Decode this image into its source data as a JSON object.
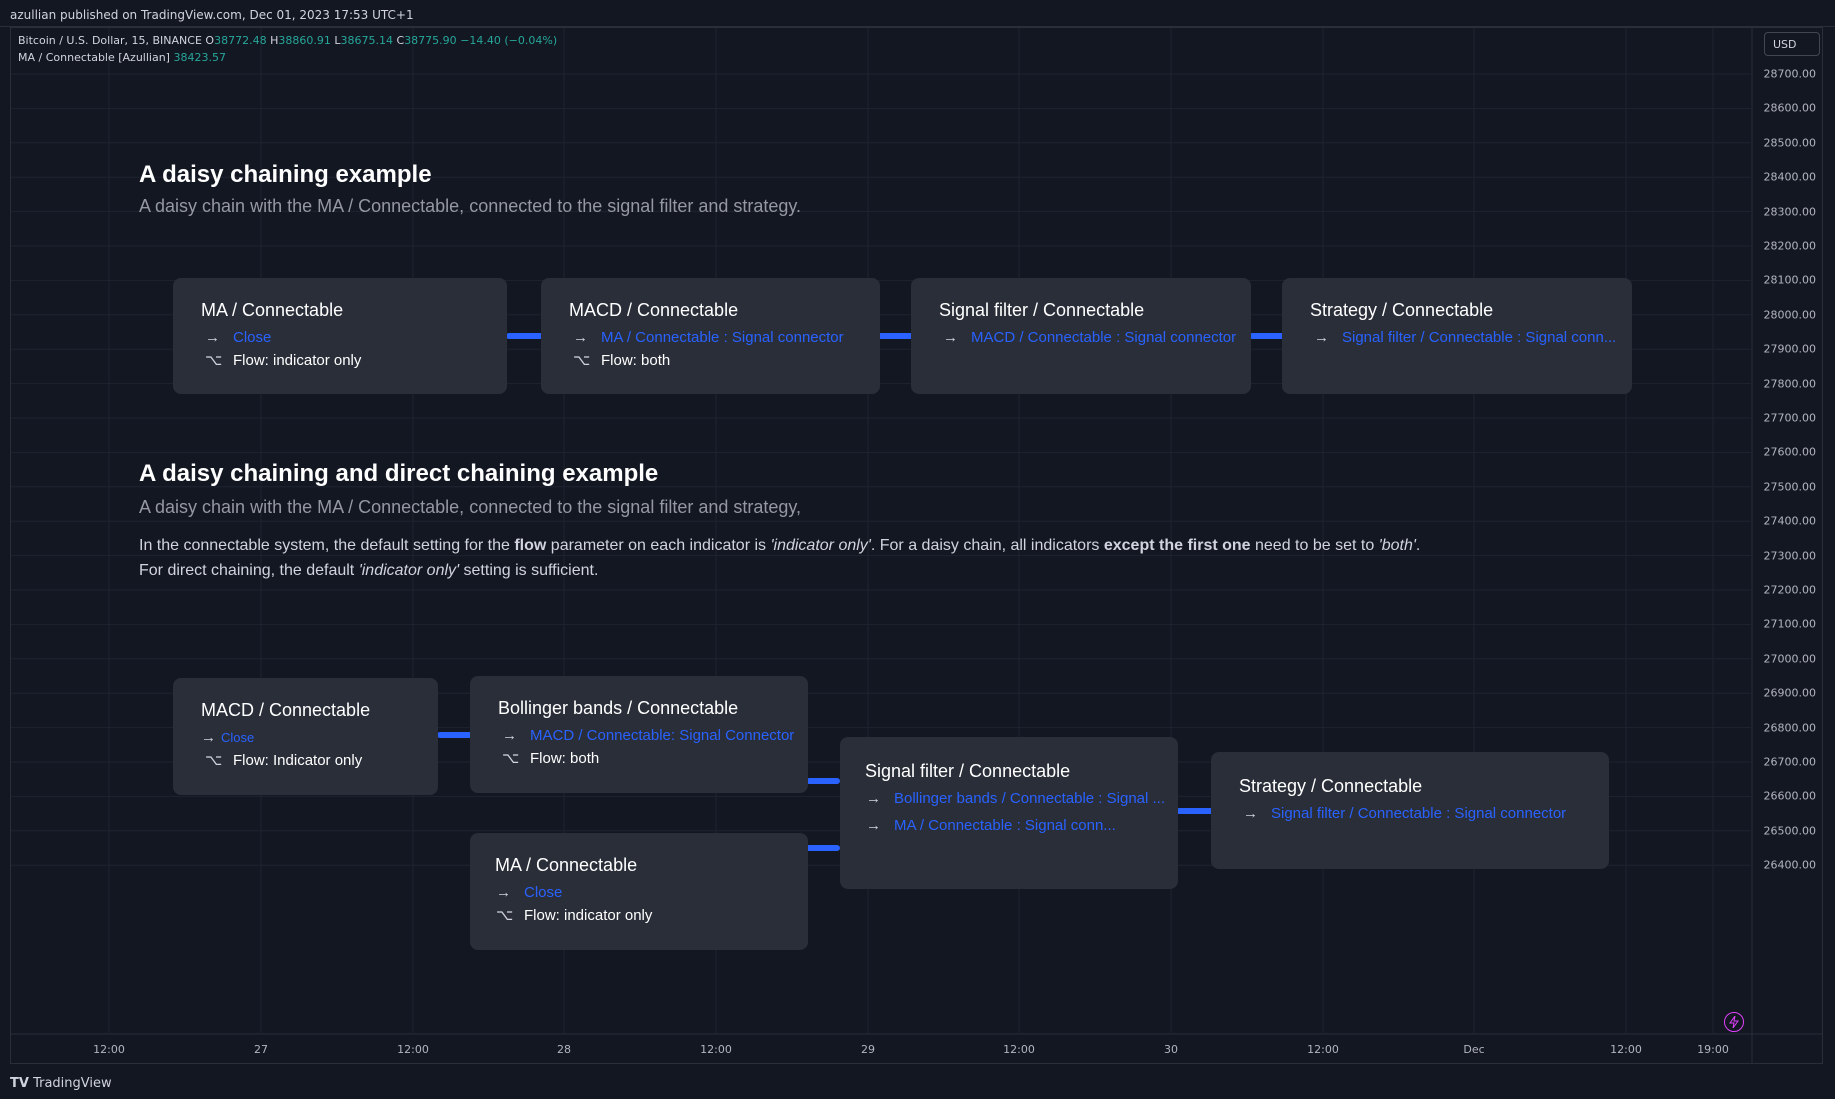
{
  "publish_line": "azullian published on TradingView.com, Dec 01, 2023 17:53 UTC+1",
  "legend": {
    "symbol": "Bitcoin / U.S. Dollar, 15, BINANCE",
    "o_key": "O",
    "o_val": "38772.48",
    "h_key": "H",
    "h_val": "38860.91",
    "l_key": "L",
    "l_val": "38675.14",
    "c_key": "C",
    "c_val": "38775.90",
    "change": "−14.40 (−0.04%)",
    "indicator": "MA / Connectable [Azullian]",
    "indicator_val": "38423.57"
  },
  "currency_button": "USD",
  "price_axis": [
    "28700.00",
    "28600.00",
    "28500.00",
    "28400.00",
    "28300.00",
    "28200.00",
    "28100.00",
    "28000.00",
    "27900.00",
    "27800.00",
    "27700.00",
    "27600.00",
    "27500.00",
    "27400.00",
    "27300.00",
    "27200.00",
    "27100.00",
    "27000.00",
    "26900.00",
    "26800.00",
    "26700.00",
    "26600.00",
    "26500.00",
    "26400.00"
  ],
  "time_axis": [
    "12:00",
    "27",
    "12:00",
    "28",
    "12:00",
    "29",
    "12:00",
    "30",
    "12:00",
    "Dec",
    "12:00",
    "19:00"
  ],
  "section1": {
    "title": "A daisy chaining example",
    "subtitle": "A daisy chain with the MA / Connectable,  connected to the signal filter and strategy."
  },
  "section2": {
    "title": "A daisy chaining and direct chaining example",
    "subtitle": "A daisy chain with the MA / Connectable,  connected to the signal filter and strategy,",
    "para1_a": "In the connectable system, the default setting for the ",
    "para1_b": "flow",
    "para1_c": " parameter on each indicator is ",
    "para1_d": "'indicator only'",
    "para1_e": ". For a daisy chain, all indicators ",
    "para1_f": "except the first one",
    "para1_g": " need to be set to ",
    "para1_h": "'both'",
    "para1_i": ".",
    "para2_a": "For direct chaining, the default ",
    "para2_b": "'indicator only'",
    "para2_c": " setting is sufficient."
  },
  "arrow_glyph": "→",
  "flow_glyph": "⌥",
  "chain1": [
    {
      "title": "MA / Connectable",
      "link": "Close",
      "flow": "Flow: indicator only"
    },
    {
      "title": "MACD / Connectable",
      "link": "MA / Connectable : Signal connector",
      "flow": "Flow: both"
    },
    {
      "title": "Signal filter / Connectable",
      "link": "MACD / Connectable : Signal connector"
    },
    {
      "title": "Strategy / Connectable",
      "link": "Signal filter / Connectable : Signal conn..."
    }
  ],
  "chain2": {
    "macd": {
      "title": "MACD / Connectable",
      "link": "Close",
      "flow": "Flow: Indicator only"
    },
    "bb": {
      "title": "Bollinger bands / Connectable",
      "link": "MACD / Connectable: Signal Connector",
      "flow": "Flow: both"
    },
    "ma": {
      "title": "MA / Connectable",
      "link": "Close",
      "flow": "Flow: indicator only"
    },
    "sf": {
      "title": "Signal filter / Connectable",
      "link1": "Bollinger bands / Connectable : Signal ...",
      "link2": "MA / Connectable : Signal conn..."
    },
    "strat": {
      "title": "Strategy / Connectable",
      "link": "Signal filter / Connectable : Signal connector"
    }
  },
  "footer_logo": "TradingView",
  "colors": {
    "background": "#131722",
    "node": "#2a2e39",
    "accent": "#2962ff",
    "up": "#26a69a"
  }
}
